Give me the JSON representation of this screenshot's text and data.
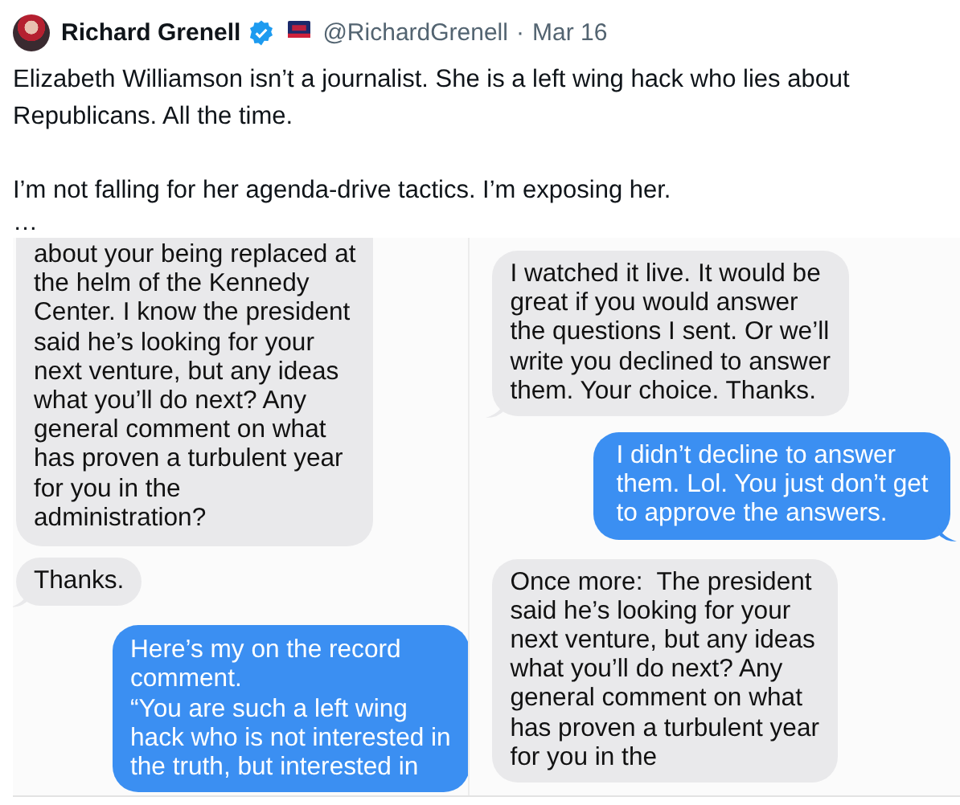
{
  "tweet": {
    "author": {
      "name": "Richard Grenell",
      "verified": true,
      "handle": "@RichardGrenell",
      "separator": "·",
      "date": "Mar 16"
    },
    "paragraphs": [
      "Elizabeth Williamson isn’t a journalist. She is a left wing hack who lies about Republicans. All the time.",
      "I’m not falling for her agenda-drive tactics. I’m exposing her."
    ],
    "more": "…"
  },
  "image": {
    "panels": [
      {
        "messages": [
          {
            "outgoing": false,
            "continues_above": true,
            "tail": false,
            "text": "about your being replaced at\nthe helm of the Kennedy\nCenter. I know the president\nsaid he’s looking for your\nnext venture, but any ideas\nwhat you’ll do next? Any\ngeneral comment on what\nhas proven a turbulent year\nfor you in the\nadministration?"
          },
          {
            "outgoing": false,
            "continues_above": false,
            "tail": true,
            "text": "Thanks."
          },
          {
            "outgoing": true,
            "continues_above": false,
            "tail": false,
            "text": "Here’s my on the record\ncomment.\n“You are such a left wing\nhack who is not interested in\nthe truth, but interested in"
          }
        ]
      },
      {
        "messages": [
          {
            "outgoing": false,
            "continues_above": false,
            "tail": true,
            "text": "I watched it live. It would be\ngreat if you would answer\nthe questions I sent. Or we’ll\nwrite you declined to answer\nthem. Your choice. Thanks."
          },
          {
            "outgoing": true,
            "continues_above": false,
            "tail": true,
            "text": "I didn’t decline to answer\nthem. Lol. You just don’t get\nto approve the answers."
          },
          {
            "outgoing": false,
            "continues_above": false,
            "tail": false,
            "text": "Once more:  The president\nsaid he’s looking for your\nnext venture, but any ideas\nwhat you’ll do next? Any\ngeneral comment on what\nhas proven a turbulent year\nfor you in the"
          }
        ]
      }
    ]
  }
}
